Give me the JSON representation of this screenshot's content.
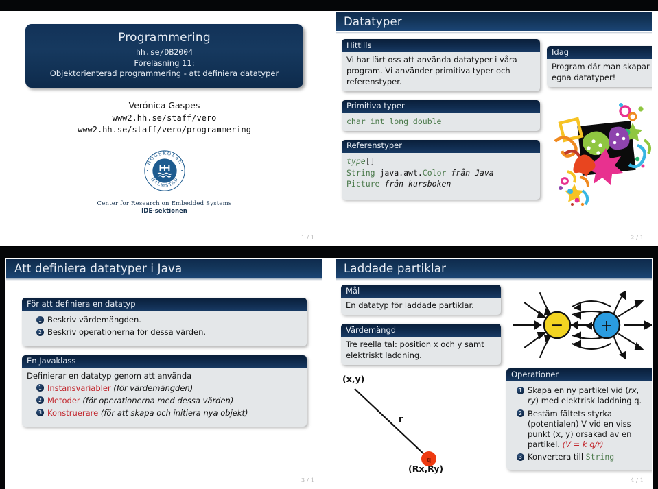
{
  "meta": {
    "accent_dark": "#0e2a4d",
    "block_body": "#e4e7e9",
    "red": "#c2272e",
    "green": "#4b7a4b"
  },
  "slide1": {
    "title": "Programmering",
    "course_code": "hh.se/DB2004",
    "lecture": "Föreläsning 11:",
    "subtitle": "Objektorienterad programmering - att definiera datatyper",
    "author": "Verónica Gaspes",
    "url1": "www2.hh.se/staff/vero",
    "url2": "www2.hh.se/staff/vero/programmering",
    "logo_top": "HÖGSKOLAN",
    "logo_bottom": "HALMSTAD",
    "logo_mark": "HH",
    "institute_line1": "Center for Research on Embedded Systems",
    "institute_line2": "IDE-sektionen",
    "page": "1 / 1"
  },
  "slide2": {
    "frame_title": "Datatyper",
    "page": "2 / 1",
    "blocks": {
      "hittills": {
        "title": "Hittills",
        "body": "Vi har lärt oss att använda datatyper i våra program. Vi använder primitiva typer och referenstyper."
      },
      "primitiva": {
        "title": "Primitiva typer",
        "code": "char int long double"
      },
      "referens": {
        "title": "Referenstyper",
        "line1_type": "type",
        "line1_brackets": "[]",
        "line2_string": "String",
        "line2_java": "java.awt.",
        "line2_color": "Color",
        "line2_from": "från Java",
        "line3_picture": "Picture",
        "line3_from": "från kursboken"
      },
      "idag": {
        "title": "Idag",
        "body": "Program där man skapar egna datatyper!"
      }
    },
    "graphic_name": "colorful-abstract-artwork"
  },
  "slide3": {
    "frame_title": "Att definiera datatyper i Java",
    "page": "3 / 1",
    "blocks": {
      "definiera": {
        "title": "För att definiera en datatyp",
        "items": [
          {
            "n": "1",
            "text": "Beskriv värdemängden."
          },
          {
            "n": "2",
            "text": "Beskriv operationerna för dessa värden."
          }
        ]
      },
      "javaklass": {
        "title": "En Javaklass",
        "intro": "Definierar en datatyp genom att använda",
        "items": [
          {
            "n": "1",
            "key": "Instansvariabler",
            "rest": "(för värdemängden)"
          },
          {
            "n": "2",
            "key": "Metoder",
            "rest": "(för operationerna med dessa värden)"
          },
          {
            "n": "3",
            "key": "Konstruerare",
            "rest": "(för att skapa och initiera nya objekt)"
          }
        ]
      }
    }
  },
  "slide4": {
    "frame_title": "Laddade partiklar",
    "page": "4 / 1",
    "blocks": {
      "mal": {
        "title": "Mål",
        "body": "En datatyp för laddade partiklar."
      },
      "vardemangd": {
        "title": "Värdemängd",
        "body": "Tre reella tal: position x och y samt elektriskt laddning."
      },
      "operationer": {
        "title": "Operationer",
        "items": [
          {
            "n": "1",
            "text_a": "Skapa en ny partikel vid (",
            "sub_a": "rx",
            "mid": ", ",
            "sub_b": "ry",
            "text_b": ") med elektrisk laddning q."
          },
          {
            "n": "2",
            "text": "Bestäm fältets styrka (potentialen) V vid en viss punkt (x, y) orsakad av en partikel.",
            "formula": "(V = k q/r)"
          },
          {
            "n": "3",
            "text": "Konvertera till",
            "code": "String"
          }
        ]
      }
    },
    "diagram": {
      "label_xy": "(x,y)",
      "label_r": "r",
      "label_q": "q",
      "label_rxry": "(Rx,Ry)"
    },
    "field_diagram": {
      "negative_symbol": "−",
      "positive_symbol": "+",
      "negative_color": "#f2d422",
      "positive_color": "#2a9ce0"
    }
  }
}
